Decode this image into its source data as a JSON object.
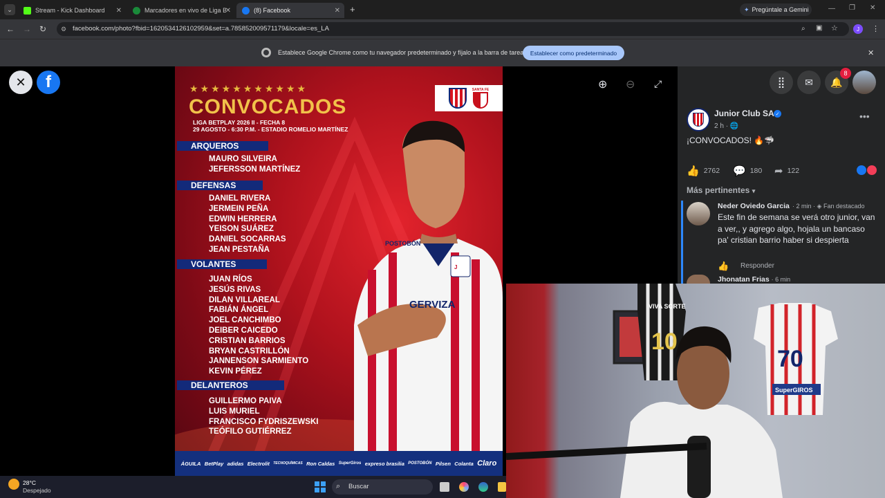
{
  "browser": {
    "tabs": [
      {
        "title": "Stream - Kick Dashboard",
        "color": "#53fc18"
      },
      {
        "title": "Marcadores en vivo de Liga Bet",
        "color": "#1a8a3a"
      },
      {
        "title": "(8) Facebook",
        "color": "#1877f2"
      }
    ],
    "gemini_label": "Pregúntale a Gemini",
    "url": "facebook.com/photo?fbid=1620534126102959&set=a.785852009571179&locale=es_LA",
    "infobar_text": "Establece Google Chrome como tu navegador predeterminado y fíjalo a la barra de tareas",
    "infobar_button": "Establecer como predeterminado",
    "profile_initial": "J"
  },
  "poster": {
    "stars": "★★★★★★★★★★★",
    "title": "CONVOCADOS",
    "subtitle1": "LIGA BETPLAY 2026 II - FECHA 8",
    "subtitle2": "29 AGOSTO - 6:30 P.M. - ESTADIO ROMELIO MARTÍNEZ",
    "away_team_label": "SANTA FE",
    "sections": [
      {
        "title": "ARQUEROS",
        "players": [
          "MAURO SILVEIRA",
          "JEFERSSON MARTÍNEZ"
        ]
      },
      {
        "title": "DEFENSAS",
        "players": [
          "DANIEL RIVERA",
          "JERMEIN PEÑA",
          "EDWIN HERRERA",
          "YEISON SUÁREZ",
          "DANIEL SOCARRAS",
          "JEAN PESTAÑA"
        ]
      },
      {
        "title": "VOLANTES",
        "players": [
          "JUAN RÍOS",
          "JESÚS RIVAS",
          "DILAN VILLAREAL",
          "FABIÁN ÁNGEL",
          "JOEL CANCHIMBO",
          "DEIBER CAICEDO",
          "CRISTIAN BARRIOS",
          "BRYAN CASTRILLÓN",
          "JANNENSON SARMIENTO",
          "KEVIN PÉREZ"
        ]
      },
      {
        "title": "DELANTEROS",
        "players": [
          "GUILLERMO PAIVA",
          "LUIS MURIEL",
          "FRANCISCO FYDRISZEWSKI",
          "TEÓFILO GUTIÉRREZ"
        ]
      }
    ],
    "sponsors": [
      "ÁGUILA",
      "BetPlay",
      "adidas",
      "Electrolit",
      "TECNOQUÍMICAS",
      "Ron Caldas",
      "SuperGiros",
      "expreso brasilia",
      "POSTOBÓN",
      "Pilsen",
      "Colanta",
      "Claro"
    ],
    "shirt_text": "GERVIZA",
    "brand_text": "POSTOBÓN"
  },
  "facebook": {
    "notification_count": "8",
    "post": {
      "author": "Junior Club SA",
      "time": "2 h",
      "text": "¡CONVOCADOS! 🔥🦈",
      "likes": "2762",
      "comments": "180",
      "shares": "122"
    },
    "filter_label": "Más pertinentes",
    "comment": {
      "author": "Neder Oviedo Garcia",
      "meta_time": "2 min",
      "badge": "Fan destacado",
      "text": "Este fin de semana se verá otro junior, van a ver,, y agrego algo, hojala un bancaso pa' cristian barrio haber si despierta",
      "reply_label": "Responder"
    },
    "comment2": {
      "author": "Jhonatan Frias",
      "meta_time": "6 min"
    }
  },
  "webcam": {
    "jersey1_text": "VIVA SORTE",
    "jersey1_number": "10",
    "jersey2_number": "70",
    "jersey2_sponsor": "SuperGIROS"
  },
  "taskbar": {
    "temperature": "28°C",
    "weather": "Despejado",
    "search_label": "Buscar"
  }
}
